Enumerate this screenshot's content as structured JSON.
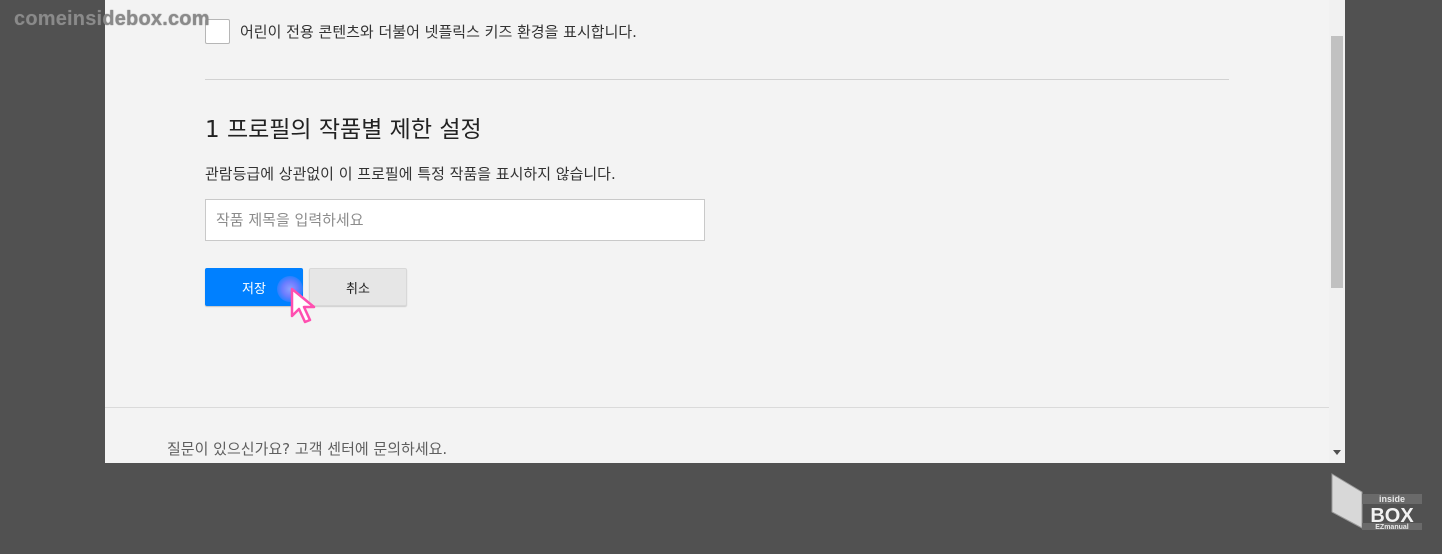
{
  "watermark": "comeinsidebox.com",
  "kids_option": {
    "label": "어린이 전용 콘텐츠와 더불어 넷플릭스 키즈 환경을 표시합니다."
  },
  "restriction": {
    "title": "1 프로필의 작품별 제한 설정",
    "description": "관람등급에 상관없이 이 프로필에 특정 작품을 표시하지 않습니다.",
    "input_placeholder": "작품 제목을 입력하세요",
    "input_value": ""
  },
  "buttons": {
    "save": "저장",
    "cancel": "취소"
  },
  "footer": {
    "help_text": "질문이 있으신가요? 고객 센터에 문의하세요."
  },
  "logo": {
    "line1": "inside",
    "line2": "BOX",
    "line3": "EZmanual"
  },
  "colors": {
    "primary_button": "#0080ff",
    "background_page": "#f3f3f3",
    "backdrop": "#515151",
    "cursor_pink": "#ff4fb0"
  }
}
